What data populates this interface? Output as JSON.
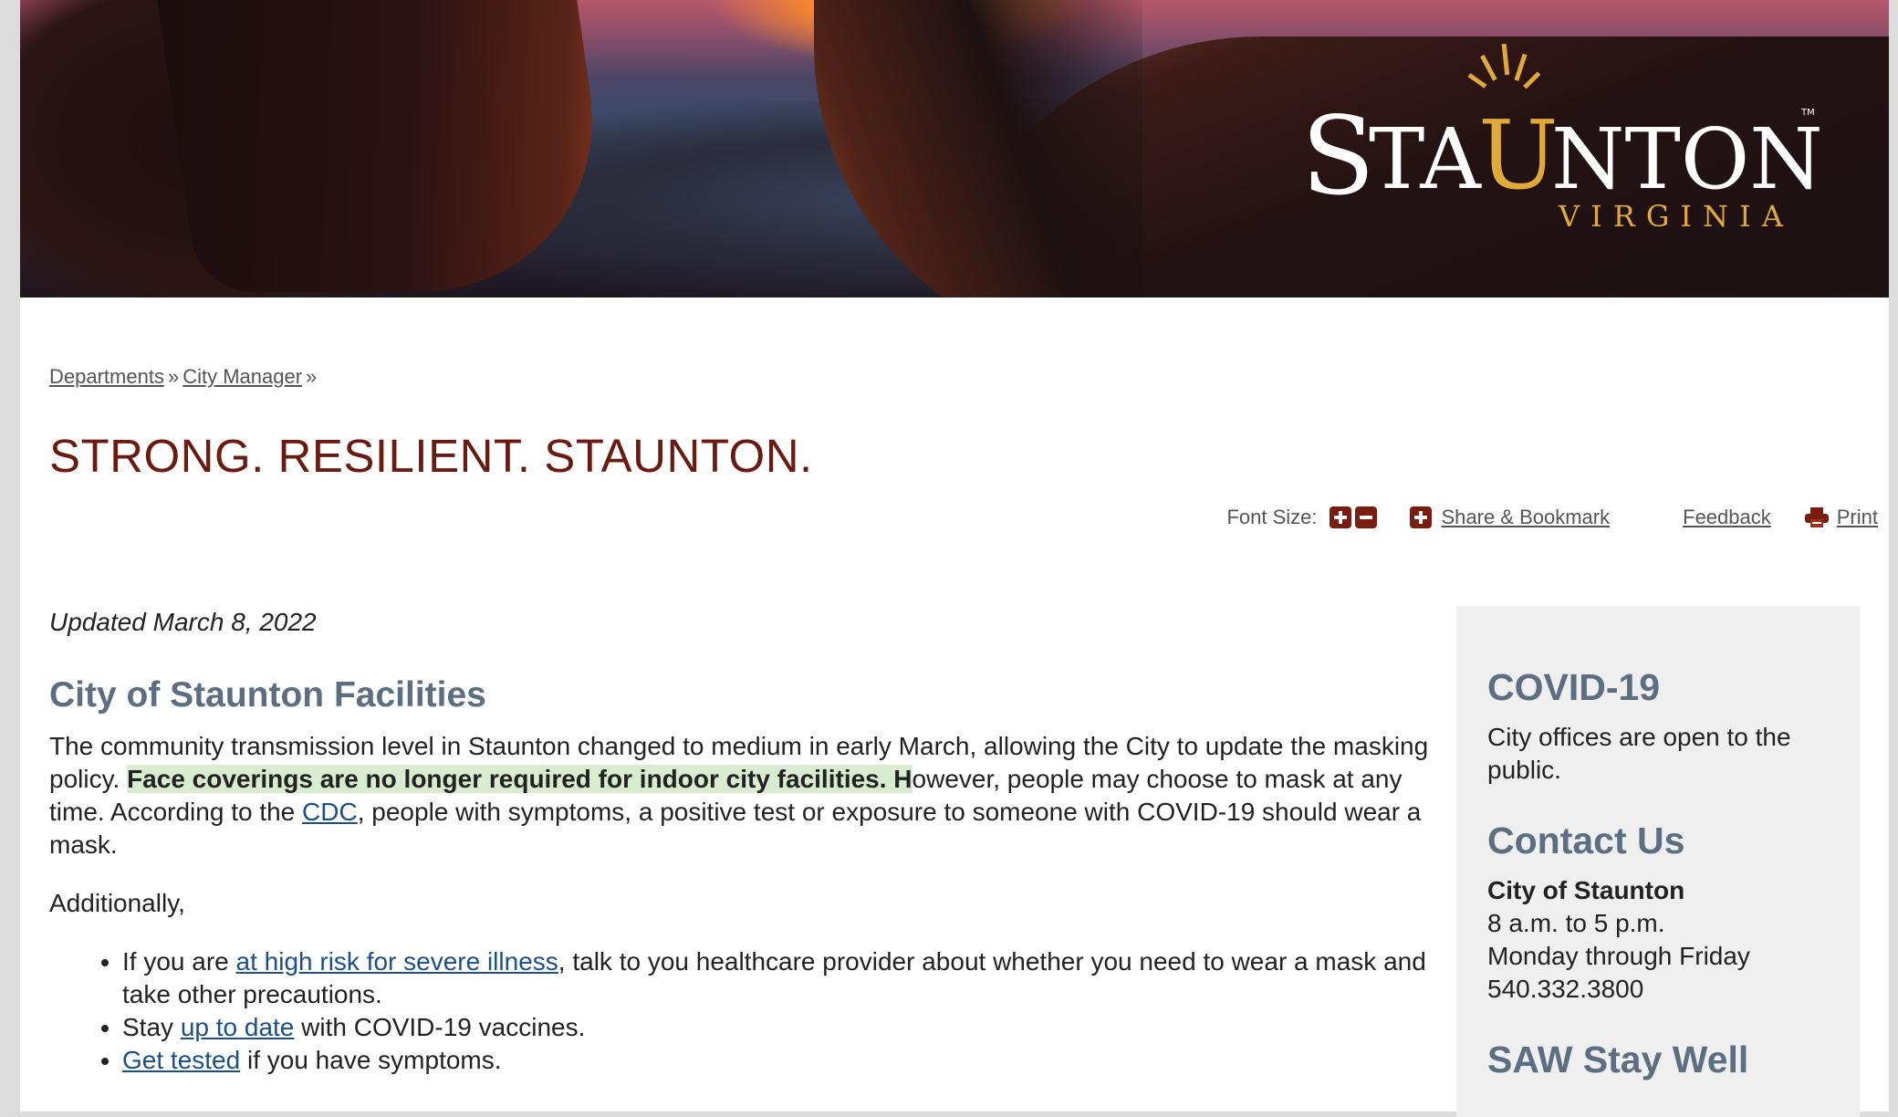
{
  "banner": {
    "logo_main": "STAUNTON",
    "logo_sub": "VIRGINIA",
    "logo_tm": "TM"
  },
  "breadcrumb": {
    "items": [
      "Departments",
      "City Manager"
    ],
    "separator": "»"
  },
  "page_title": "STRONG. RESILIENT. STAUNTON.",
  "toolbar": {
    "font_size_label": "Font Size:",
    "share_label": "Share & Bookmark",
    "feedback_label": "Feedback",
    "print_label": "Print"
  },
  "main": {
    "updated": "Updated March 8, 2022",
    "section_title": "City of Staunton Facilities",
    "p1_a": "The community transmission level in Staunton changed to medium in early March, allowing the City to update the masking policy. ",
    "p1_highlight": "Face coverings are no longer required for indoor city facilities. H",
    "p1_b": "owever, people may choose to mask at any time. According to the ",
    "p1_link": "CDC",
    "p1_c": ", people with symptoms, a positive test or exposure to someone with COVID-19 should wear a mask.",
    "additionally": "Additionally,",
    "bullets": [
      {
        "pre": "If you are ",
        "link": "at high risk for severe illness",
        "post": ", talk to you healthcare provider about whether you need to wear a mask and take other precautions."
      },
      {
        "pre": "Stay ",
        "link": "up to date",
        "post": " with COVID-19 vaccines."
      },
      {
        "pre": "",
        "link": "Get tested",
        "post": " if you have symptoms."
      }
    ]
  },
  "sidebar": {
    "covid_title": "COVID-19",
    "covid_text": "City offices are open to the public.",
    "contact_title": "Contact Us",
    "contact_name": "City of Staunton",
    "contact_hours": "8 a.m. to 5 p.m.",
    "contact_days": "Monday through Friday",
    "contact_phone": "540.332.3800",
    "saw_title": "SAW Stay Well"
  },
  "colors": {
    "title_red": "#6b1a0f",
    "heading_slate": "#5b6e82",
    "link_blue": "#1b4f8a",
    "highlight_green": "#d8ecd0",
    "logo_gold": "#e0a93a"
  }
}
